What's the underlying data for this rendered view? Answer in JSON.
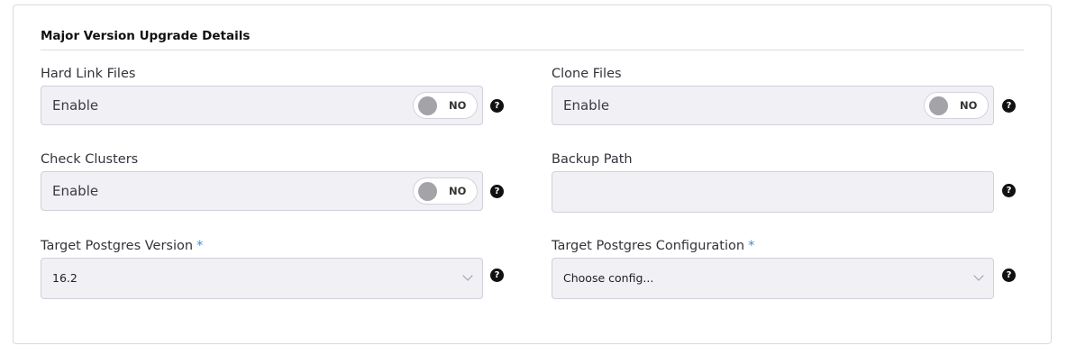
{
  "section": {
    "title": "Major Version Upgrade Details"
  },
  "fields": {
    "hard_link": {
      "label": "Hard Link Files",
      "value": "Enable",
      "toggle": "NO"
    },
    "clone_files": {
      "label": "Clone Files",
      "value": "Enable",
      "toggle": "NO"
    },
    "check_clusters": {
      "label": "Check Clusters",
      "value": "Enable",
      "toggle": "NO"
    },
    "backup_path": {
      "label": "Backup Path",
      "value": ""
    },
    "target_version": {
      "label": "Target Postgres Version",
      "required_mark": "*",
      "value": "16.2"
    },
    "target_config": {
      "label": "Target Postgres Configuration",
      "required_mark": "*",
      "value": "Choose config..."
    }
  },
  "help_icon_text": "?",
  "icons": {
    "help": "question-circle-icon",
    "toggle_knob": "toggle-knob",
    "dropdown": "chevron-down-icon"
  },
  "colors": {
    "required": "#2f8ff0",
    "field_bg": "#f0f0f5",
    "knob": "#a3a3a8"
  }
}
